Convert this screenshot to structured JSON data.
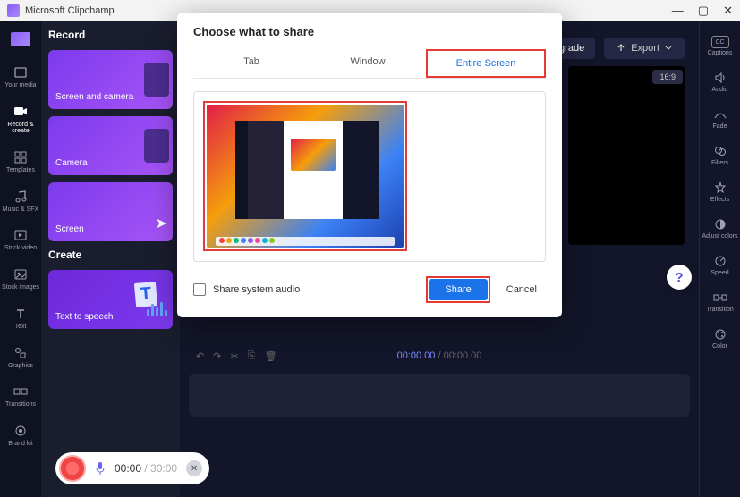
{
  "app": {
    "title": "Microsoft Clipchamp"
  },
  "window_controls": {
    "minimize": "—",
    "maximize": "▢",
    "close": "✕"
  },
  "sidebar_left": {
    "items": [
      {
        "label": "Your media"
      },
      {
        "label": "Record & create"
      },
      {
        "label": "Templates"
      },
      {
        "label": "Music & SFX"
      },
      {
        "label": "Stock video"
      },
      {
        "label": "Stock images"
      },
      {
        "label": "Text"
      },
      {
        "label": "Graphics"
      },
      {
        "label": "Transitions"
      },
      {
        "label": "Brand kit"
      }
    ]
  },
  "record_panel": {
    "title_record": "Record",
    "title_create": "Create",
    "cards": {
      "screen_camera": "Screen and camera",
      "camera": "Camera",
      "screen": "Screen",
      "tts": "Text to speech"
    }
  },
  "top_actions": {
    "upgrade": "Upgrade",
    "export": "Export"
  },
  "aspect": "16:9",
  "timeline": {
    "current": "00:00.00",
    "total": "00:00.00"
  },
  "record_pill": {
    "current": "00:00",
    "total": "30:00"
  },
  "sidebar_right": {
    "items": [
      {
        "label": "Captions"
      },
      {
        "label": "Audio"
      },
      {
        "label": "Fade"
      },
      {
        "label": "Filters"
      },
      {
        "label": "Effects"
      },
      {
        "label": "Adjust colors"
      },
      {
        "label": "Speed"
      },
      {
        "label": "Transition"
      },
      {
        "label": "Color"
      }
    ],
    "cc": "CC"
  },
  "modal": {
    "title": "Choose what to share",
    "tabs": {
      "tab": "Tab",
      "window": "Window",
      "entire": "Entire Screen"
    },
    "share_audio": "Share system audio",
    "share_btn": "Share",
    "cancel_btn": "Cancel"
  },
  "help": "?"
}
